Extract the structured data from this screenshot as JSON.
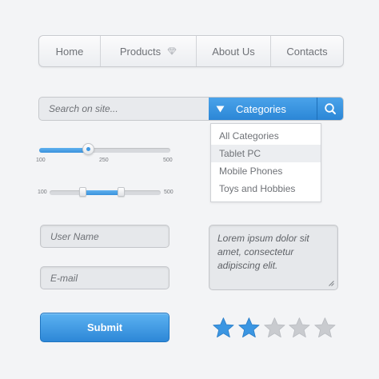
{
  "nav": {
    "items": [
      {
        "label": "Home"
      },
      {
        "label": "Products",
        "icon": "diamond-icon"
      },
      {
        "label": "About Us"
      },
      {
        "label": "Contacts"
      }
    ]
  },
  "search": {
    "placeholder": "Search on site...",
    "category_label": "Categories",
    "category_icon": "triangle-down-icon",
    "search_icon": "search-icon"
  },
  "dropdown": {
    "items": [
      "All Categories",
      "Tablet PC",
      "Mobile Phones",
      "Toys and Hobbies"
    ],
    "highlighted": "Tablet PC"
  },
  "slider1": {
    "min_label": "100",
    "mid_label": "250",
    "max_label": "500",
    "value": 250
  },
  "slider2": {
    "min_label": "100",
    "max_label": "500",
    "range_start_fraction": 0.3,
    "range_end_fraction": 0.65
  },
  "form": {
    "username_placeholder": "User Name",
    "email_placeholder": "E-mail",
    "textarea_text": "Lorem ipsum dolor sit amet, consectetur adipiscing elit.",
    "submit_label": "Submit"
  },
  "rating": {
    "value": 2,
    "max": 5
  },
  "colors": {
    "accent": "#3a93de",
    "star_on": "#3b96e2",
    "star_off": "#c9cbcf",
    "background": "#f3f4f6"
  }
}
